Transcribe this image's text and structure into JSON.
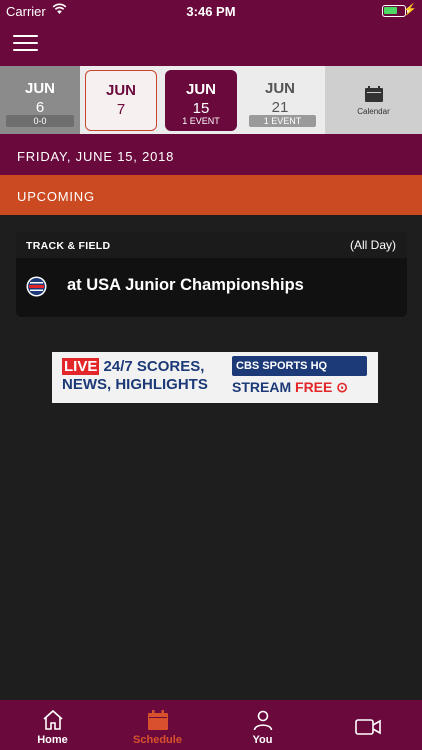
{
  "status": {
    "carrier": "Carrier",
    "time": "3:46 PM"
  },
  "dates": [
    {
      "month": "JUN",
      "day": "6",
      "badge": "0-0"
    },
    {
      "month": "JUN",
      "day": "7",
      "badge": ""
    },
    {
      "month": "JUN",
      "day": "15",
      "badge": "1 EVENT"
    },
    {
      "month": "JUN",
      "day": "21",
      "badge": "1 EVENT"
    }
  ],
  "calendar_label": "Calendar",
  "date_heading": "FRIDAY, JUNE 15, 2018",
  "section_label": "UPCOMING",
  "event": {
    "sport": "TRACK & FIELD",
    "time": "(All Day)",
    "title": "at USA Junior Championships"
  },
  "ad": {
    "live": "LIVE",
    "line1_rest": " 24/7 SCORES,",
    "line2": "NEWS, HIGHLIGHTS",
    "brand": "CBS SPORTS HQ",
    "stream": "STREAM",
    "free": "FREE"
  },
  "tabs": [
    {
      "label": "Home",
      "icon": "home-icon"
    },
    {
      "label": "Schedule",
      "icon": "calendar-icon",
      "active": true
    },
    {
      "label": "You",
      "icon": "person-icon"
    },
    {
      "label": "",
      "icon": "video-icon"
    }
  ],
  "colors": {
    "maroon": "#6a0a3c",
    "orange": "#cc4a22",
    "active_tab": "#d9512c"
  }
}
